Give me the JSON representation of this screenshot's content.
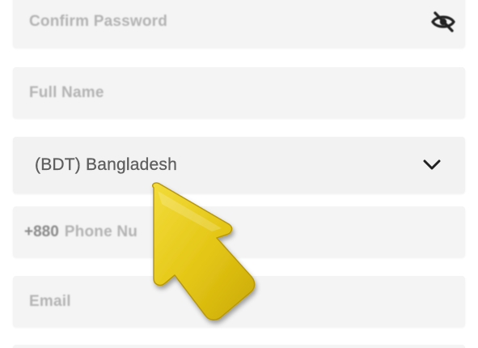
{
  "form": {
    "confirm_password": {
      "placeholder": "Confirm Password",
      "toggle_icon": "eye-off-icon"
    },
    "full_name": {
      "placeholder": "Full Name"
    },
    "currency_country": {
      "value": "(BDT) Bangladesh",
      "dropdown_icon": "chevron-down-icon"
    },
    "phone": {
      "country_code": "+880",
      "placeholder": "Phone Nu"
    },
    "email": {
      "placeholder": "Email"
    }
  },
  "overlay": {
    "pointer_icon": "yellow-arrow-pointer-icon",
    "pointer_color": "#e6c71a"
  },
  "colors": {
    "field_bg": "#f4f4f4",
    "placeholder": "#b3b3b3",
    "value_text": "#5f5f5f"
  }
}
